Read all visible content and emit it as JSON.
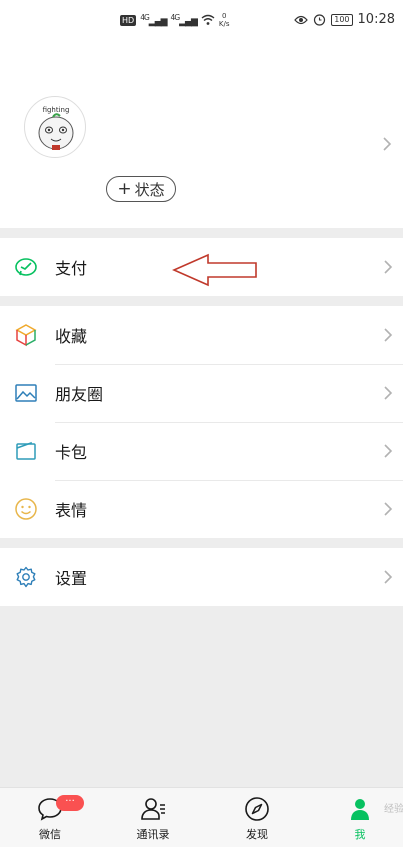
{
  "status_bar": {
    "hd_label": "HD",
    "signal_1": "4G",
    "signal_2": "4G",
    "net_speed_value": "0",
    "net_speed_unit": "K/s",
    "battery": "100",
    "time": "10:28"
  },
  "profile": {
    "avatar_text": "fighting",
    "status_button_label": "状态",
    "status_button_plus": "+"
  },
  "menu": {
    "pay": {
      "label": "支付",
      "icon": "pay-icon"
    },
    "favorites": {
      "label": "收藏",
      "icon": "cube-icon"
    },
    "moments": {
      "label": "朋友圈",
      "icon": "image-icon"
    },
    "cards": {
      "label": "卡包",
      "icon": "wallet-icon"
    },
    "stickers": {
      "label": "表情",
      "icon": "smile-icon"
    },
    "settings": {
      "label": "设置",
      "icon": "gear-icon"
    }
  },
  "tabbar": {
    "tabs": [
      {
        "label": "微信",
        "icon": "chat-bubble-icon",
        "badge": "···"
      },
      {
        "label": "通讯录",
        "icon": "contacts-icon"
      },
      {
        "label": "发现",
        "icon": "compass-icon"
      },
      {
        "label": "我",
        "icon": "person-icon",
        "active": true
      }
    ],
    "watermark": "经验"
  },
  "colors": {
    "accent_green": "#07c160",
    "badge_red": "#fa5151",
    "annotation_arrow": "#c0392b",
    "page_background": "#ededed"
  }
}
